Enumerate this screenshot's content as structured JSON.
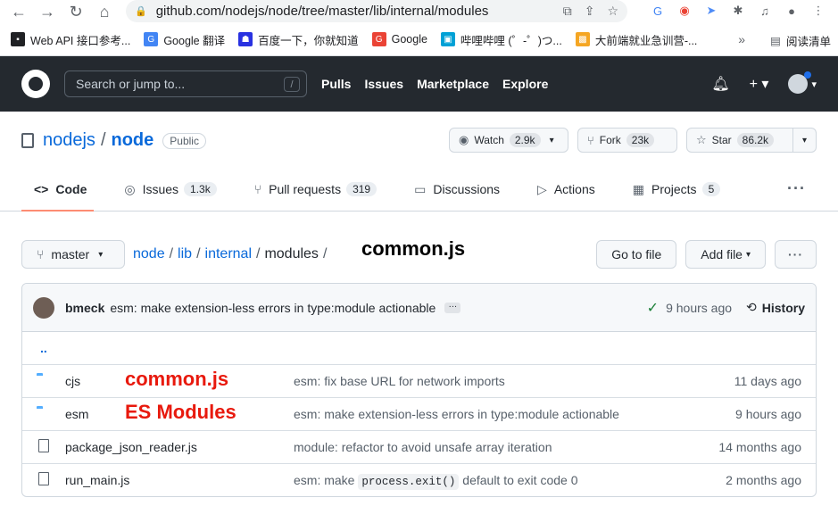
{
  "browser": {
    "url": "github.com/nodejs/node/tree/master/lib/internal/modules",
    "bookmarks": [
      {
        "label": "Web API 接口参考...",
        "color": "#202124"
      },
      {
        "label": "Google 翻译",
        "color": "#4285f4"
      },
      {
        "label": "百度一下，你就知道",
        "color": "#2932e1"
      },
      {
        "label": "Google",
        "color": "#ea4335"
      },
      {
        "label": "哔哩哔哩 (゜-゜)つ...",
        "color": "#00a1d6"
      },
      {
        "label": "大前端就业急训营-...",
        "color": "#f5a623"
      }
    ],
    "more": "»",
    "reading_list": "阅读清单"
  },
  "github": {
    "search_placeholder": "Search or jump to...",
    "slash": "/",
    "nav": [
      "Pulls",
      "Issues",
      "Marketplace",
      "Explore"
    ]
  },
  "repo": {
    "owner": "nodejs",
    "sep": "/",
    "name": "node",
    "visibility": "Public",
    "watch": {
      "label": "Watch",
      "count": "2.9k"
    },
    "fork": {
      "label": "Fork",
      "count": "23k"
    },
    "star": {
      "label": "Star",
      "count": "86.2k"
    }
  },
  "tabs": [
    {
      "label": "Code",
      "count": null,
      "icon": "<>"
    },
    {
      "label": "Issues",
      "count": "1.3k",
      "icon": "◎"
    },
    {
      "label": "Pull requests",
      "count": "319",
      "icon": "⑂"
    },
    {
      "label": "Discussions",
      "count": null,
      "icon": "▭"
    },
    {
      "label": "Actions",
      "count": null,
      "icon": "▷"
    },
    {
      "label": "Projects",
      "count": "5",
      "icon": "▦"
    }
  ],
  "filenav": {
    "branch": "master",
    "crumbs": [
      "node",
      "lib",
      "internal"
    ],
    "current": "modules",
    "trailing_sep": "/",
    "annotation": "common.js",
    "go_to_file": "Go to file",
    "add_file": "Add file"
  },
  "commit": {
    "author": "bmeck",
    "message": "esm: make extension-less errors in type:module actionable",
    "ellipsis": "…",
    "time": "9 hours ago",
    "history": "History"
  },
  "up_dir": "..",
  "files": [
    {
      "type": "dir",
      "name": "cjs",
      "message": "esm: fix base URL for network imports",
      "age": "11 days ago",
      "annotation": "common.js"
    },
    {
      "type": "dir",
      "name": "esm",
      "message": "esm: make extension-less errors in type:module actionable",
      "age": "9 hours ago",
      "annotation": "ES Modules"
    },
    {
      "type": "file",
      "name": "package_json_reader.js",
      "message": "module: refactor to avoid unsafe array iteration",
      "age": "14 months ago",
      "annotation": ""
    },
    {
      "type": "file",
      "name": "run_main.js",
      "message_pre": "esm: make ",
      "message_code": "process.exit()",
      "message_post": " default to exit code 0",
      "age": "2 months ago",
      "annotation": ""
    }
  ]
}
